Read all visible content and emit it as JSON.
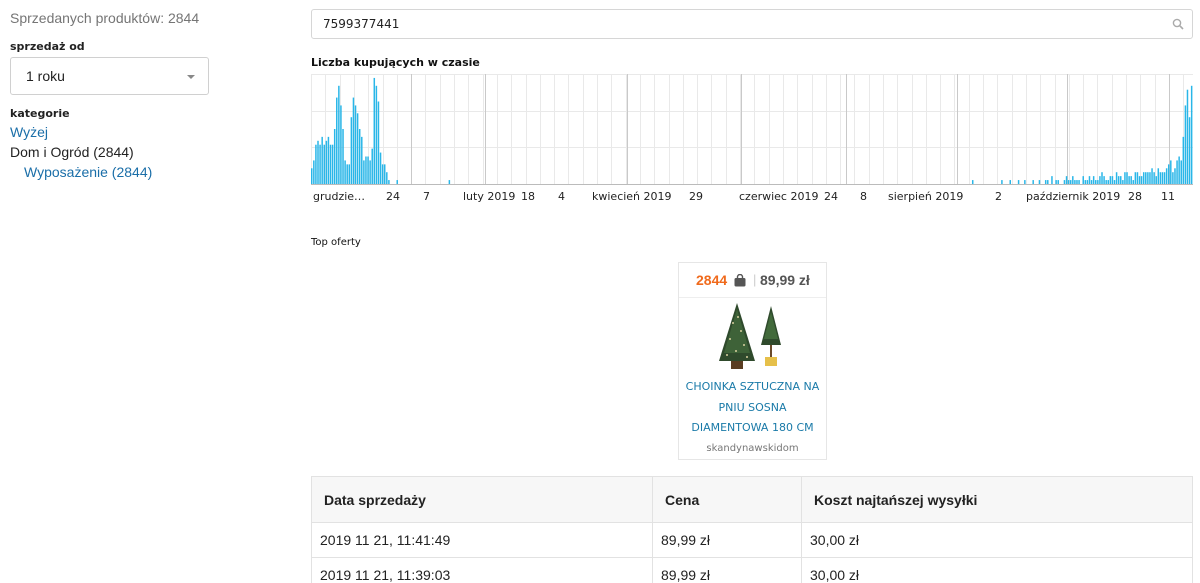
{
  "sidebar": {
    "sold_products": "Sprzedanych produktów: 2844",
    "sale_from_label": "sprzedaż od",
    "sale_from_value": "1 roku",
    "categories_label": "kategorie",
    "categories": {
      "up": "Wyżej",
      "current": "Dom i Ogród (2844)",
      "sub": "Wyposażenie (2844)"
    }
  },
  "search": {
    "value": "7599377441"
  },
  "chart_data": {
    "type": "bar",
    "title": "Liczba kupujących w czasie",
    "xlabel": "",
    "ylabel": "",
    "x_tick_labels": [
      "grudzie…",
      "24",
      "7",
      "luty 2019",
      "18",
      "4",
      "kwiecień 2019",
      "29",
      "czerwiec 2019",
      "24",
      "8",
      "sierpień 2019",
      "2",
      "październik 2019",
      "28",
      "11"
    ],
    "grid": true,
    "values": [
      4,
      6,
      10,
      11,
      10,
      12,
      10,
      11,
      12,
      10,
      10,
      14,
      22,
      25,
      20,
      14,
      6,
      5,
      5,
      17,
      22,
      20,
      18,
      14,
      12,
      6,
      7,
      7,
      6,
      9,
      27,
      25,
      21,
      8,
      5,
      5,
      3,
      1,
      0,
      0,
      0,
      1,
      0,
      0,
      0,
      0,
      0,
      0,
      0,
      0,
      0,
      0,
      0,
      0,
      0,
      0,
      0,
      0,
      0,
      0,
      0,
      0,
      0,
      0,
      0,
      0,
      1,
      0,
      0,
      0,
      0,
      0,
      0,
      0,
      0,
      0,
      0,
      0,
      0,
      0,
      0,
      0,
      0,
      0,
      0,
      0,
      0,
      0,
      0,
      0,
      0,
      0,
      0,
      0,
      0,
      0,
      0,
      0,
      0,
      0,
      0,
      0,
      0,
      0,
      0,
      0,
      0,
      0,
      0,
      0,
      0,
      0,
      0,
      0,
      0,
      0,
      0,
      0,
      0,
      0,
      0,
      0,
      0,
      0,
      0,
      0,
      0,
      0,
      0,
      0,
      0,
      0,
      0,
      0,
      0,
      0,
      0,
      0,
      0,
      0,
      0,
      0,
      0,
      0,
      0,
      0,
      0,
      0,
      0,
      0,
      0,
      0,
      0,
      0,
      0,
      0,
      0,
      0,
      0,
      0,
      0,
      0,
      0,
      0,
      0,
      0,
      0,
      0,
      0,
      0,
      0,
      0,
      0,
      0,
      0,
      0,
      0,
      0,
      0,
      0,
      0,
      0,
      0,
      0,
      0,
      0,
      0,
      0,
      0,
      0,
      0,
      0,
      0,
      0,
      0,
      0,
      0,
      0,
      0,
      0,
      0,
      0,
      0,
      0,
      0,
      0,
      0,
      0,
      0,
      0,
      0,
      0,
      0,
      0,
      0,
      0,
      0,
      0,
      0,
      0,
      0,
      0,
      0,
      0,
      0,
      0,
      0,
      0,
      0,
      0,
      0,
      0,
      0,
      0,
      0,
      0,
      0,
      0,
      0,
      0,
      0,
      0,
      0,
      0,
      0,
      0,
      0,
      0,
      0,
      0,
      0,
      0,
      0,
      0,
      0,
      0,
      0,
      0,
      0,
      0,
      0,
      0,
      0,
      0,
      0,
      0,
      0,
      0,
      0,
      0,
      0,
      0,
      0,
      0,
      0,
      0,
      0,
      0,
      0,
      0,
      0,
      0,
      0,
      0,
      0,
      0,
      0,
      0,
      0,
      0,
      0,
      0,
      0,
      0,
      0,
      0,
      0,
      0,
      0,
      0,
      0,
      0,
      0,
      0,
      0,
      0,
      0,
      0,
      0,
      0,
      0,
      0,
      0,
      0,
      0,
      0,
      0,
      1,
      0,
      0,
      0,
      0,
      0,
      0,
      0,
      0,
      0,
      0,
      0,
      0,
      0,
      1,
      0,
      0,
      0,
      1,
      0,
      0,
      0,
      1,
      0,
      0,
      1,
      0,
      0,
      0,
      1,
      0,
      0,
      1,
      0,
      0,
      1,
      1,
      0,
      2,
      0,
      1,
      1,
      0,
      0,
      1,
      2,
      1,
      1,
      2,
      1,
      1,
      1,
      0,
      2,
      1,
      1,
      2,
      1,
      2,
      1,
      1,
      2,
      3,
      2,
      1,
      1,
      2,
      2,
      1,
      3,
      2,
      2,
      1,
      3,
      3,
      2,
      2,
      1,
      3,
      3,
      2,
      2,
      3,
      3,
      3,
      3,
      4,
      3,
      2,
      4,
      3,
      3,
      3,
      4,
      5,
      6,
      3,
      4,
      6,
      7,
      6,
      12,
      20,
      24,
      17,
      25
    ],
    "colors": {
      "bar": "#29b6e8",
      "grid": "#e9e9e9",
      "major_grid": "#c9c9c9"
    }
  },
  "top_offers": {
    "label": "Top oferty",
    "offer": {
      "sold": "2844",
      "price": "89,99 zł",
      "name": "CHOINKA SZTUCZNA NA PNIU SOSNA DIAMENTOWA 180 CM",
      "seller": "skandynawskidom",
      "icon": "shopping-bag-icon",
      "accent": "#f06a1c"
    }
  },
  "sales_table": {
    "headers": [
      "Data sprzedaży",
      "Cena",
      "Koszt najtańszej wysyłki"
    ],
    "rows": [
      [
        "2019 11 21, 11:41:49",
        "89,99 zł",
        "30,00 zł"
      ],
      [
        "2019 11 21, 11:39:03",
        "89,99 zł",
        "30,00 zł"
      ]
    ]
  }
}
